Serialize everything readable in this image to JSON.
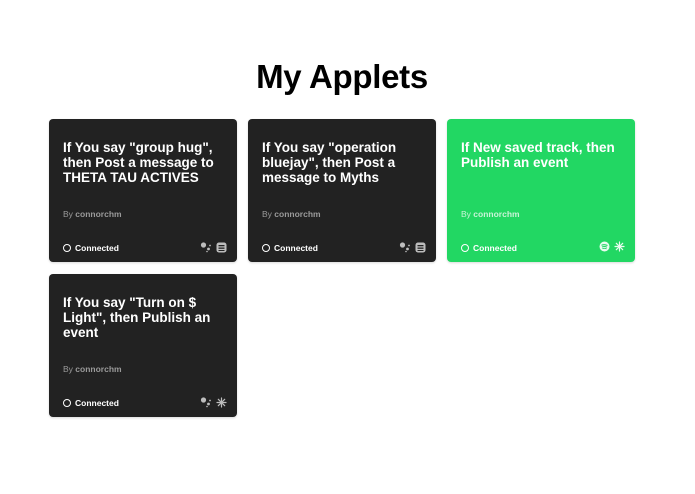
{
  "page": {
    "title": "My Applets"
  },
  "applets": [
    {
      "title": "If You say \"group hug\", then Post a message to THETA TAU ACTIVES",
      "author_prefix": "By",
      "author": "connorchm",
      "status": "Connected",
      "color": "#222222",
      "icons": [
        "google-assistant-icon",
        "slack-icon"
      ]
    },
    {
      "title": "If You say \"operation bluejay\", then Post a message to Myths",
      "author_prefix": "By",
      "author": "connorchm",
      "status": "Connected",
      "color": "#222222",
      "icons": [
        "google-assistant-icon",
        "slack-icon"
      ]
    },
    {
      "title": "If New saved track, then Publish an event",
      "author_prefix": "By",
      "author": "connorchm",
      "status": "Connected",
      "color": "#22d763",
      "icons": [
        "spotify-icon",
        "particle-icon"
      ]
    },
    {
      "title": "If You say \"Turn on $ Light\", then Publish an event",
      "author_prefix": "By",
      "author": "connorchm",
      "status": "Connected",
      "color": "#222222",
      "icons": [
        "google-assistant-icon",
        "particle-icon"
      ]
    }
  ]
}
